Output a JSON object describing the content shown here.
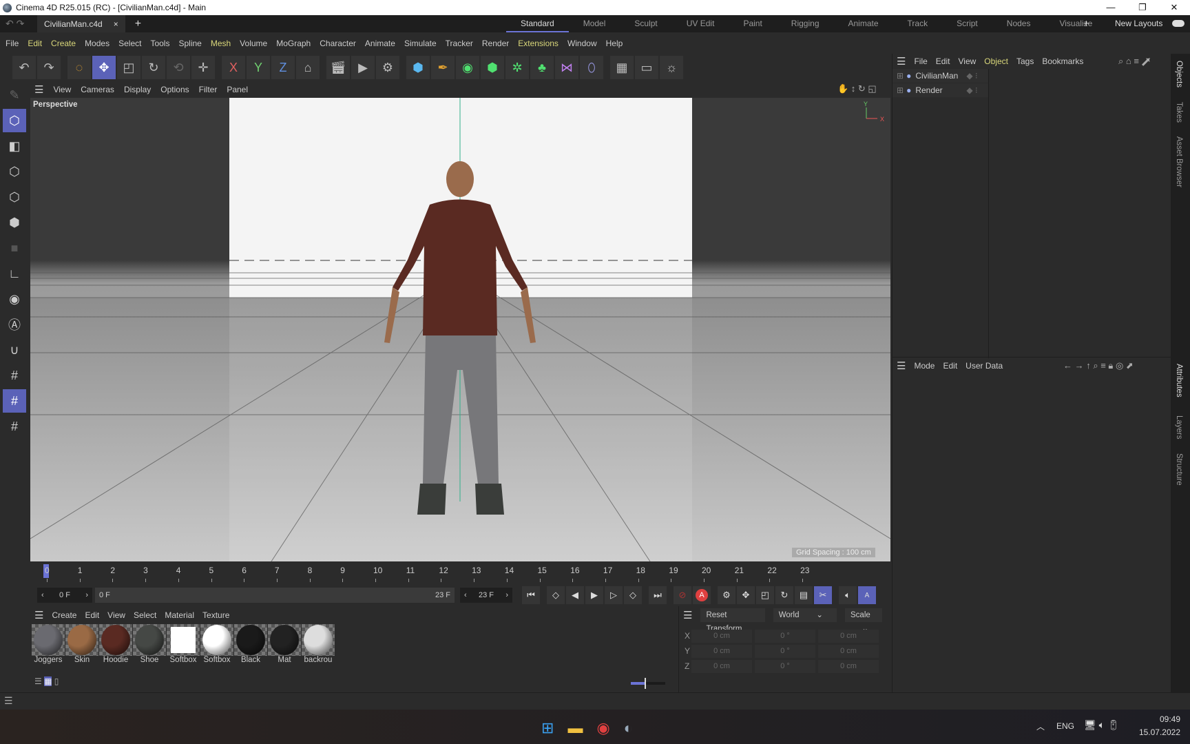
{
  "window": {
    "title": "Cinema 4D R25.015 (RC) - [CivilianMan.c4d] - Main",
    "min": "—",
    "max": "❐",
    "close": "✕"
  },
  "tabs": {
    "doc": "CivilianMan.c4d",
    "close": "×",
    "add": "+"
  },
  "layouts": {
    "items": [
      "Standard",
      "Model",
      "Sculpt",
      "UV Edit",
      "Paint",
      "Rigging",
      "Animate",
      "Track",
      "Script",
      "Nodes",
      "Visualize"
    ],
    "add": "+",
    "new_layouts": "New Layouts"
  },
  "menu": [
    "File",
    "Edit",
    "Create",
    "Modes",
    "Select",
    "Tools",
    "Spline",
    "Mesh",
    "Volume",
    "MoGraph",
    "Character",
    "Animate",
    "Simulate",
    "Tracker",
    "Render",
    "Extensions",
    "Window",
    "Help"
  ],
  "toolbar": {
    "x": "X",
    "y": "Y",
    "z": "Z"
  },
  "viewport": {
    "menu": [
      "View",
      "Cameras",
      "Display",
      "Options",
      "Filter",
      "Panel"
    ],
    "label": "Perspective",
    "grid": "Grid Spacing : 100 cm",
    "axis_y": "Y",
    "axis_x": "X"
  },
  "timeline": {
    "ticks": [
      "0",
      "1",
      "2",
      "3",
      "4",
      "5",
      "6",
      "7",
      "8",
      "9",
      "10",
      "11",
      "12",
      "13",
      "14",
      "15",
      "16",
      "17",
      "18",
      "19",
      "20",
      "21",
      "22",
      "23"
    ],
    "current": "0 F",
    "start": "0 F",
    "end": "23 F",
    "max": "23 F"
  },
  "materials": {
    "menu": [
      "Create",
      "Edit",
      "View",
      "Select",
      "Material",
      "Texture"
    ],
    "items": [
      {
        "name": "Joggers",
        "color": "#6a6a70"
      },
      {
        "name": "Skin",
        "color": "#9a6a45"
      },
      {
        "name": "Hoodie",
        "color": "#5a2a22"
      },
      {
        "name": "Shoe",
        "color": "#454845"
      },
      {
        "name": "Softbox",
        "color": "#ffffff"
      },
      {
        "name": "Softbox",
        "color": "#ffffff"
      },
      {
        "name": "Black",
        "color": "#1a1a1a"
      },
      {
        "name": "Mat",
        "color": "#222222"
      },
      {
        "name": "backrou",
        "color": "#dddddd"
      }
    ]
  },
  "coords": {
    "reset": "Reset Transform",
    "space": "World",
    "mode": "Scale",
    "rows": [
      {
        "axis": "X",
        "pos": "0 cm",
        "rot": "0 °",
        "size": "0 cm"
      },
      {
        "axis": "Y",
        "pos": "0 cm",
        "rot": "0 °",
        "size": "0 cm"
      },
      {
        "axis": "Z",
        "pos": "0 cm",
        "rot": "0 °",
        "size": "0 cm"
      }
    ]
  },
  "objects": {
    "menu": [
      "File",
      "Edit",
      "View",
      "Object",
      "Tags",
      "Bookmarks"
    ],
    "items": [
      "CivilianMan",
      "Render"
    ]
  },
  "attributes": {
    "menu": [
      "Mode",
      "Edit",
      "User Data"
    ]
  },
  "side_tabs": [
    "Objects",
    "Takes",
    "Asset Browser",
    "Attributes",
    "Layers",
    "Structure"
  ],
  "taskbar": {
    "lang": "ENG",
    "time": "09:49",
    "date": "15.07.2022"
  }
}
